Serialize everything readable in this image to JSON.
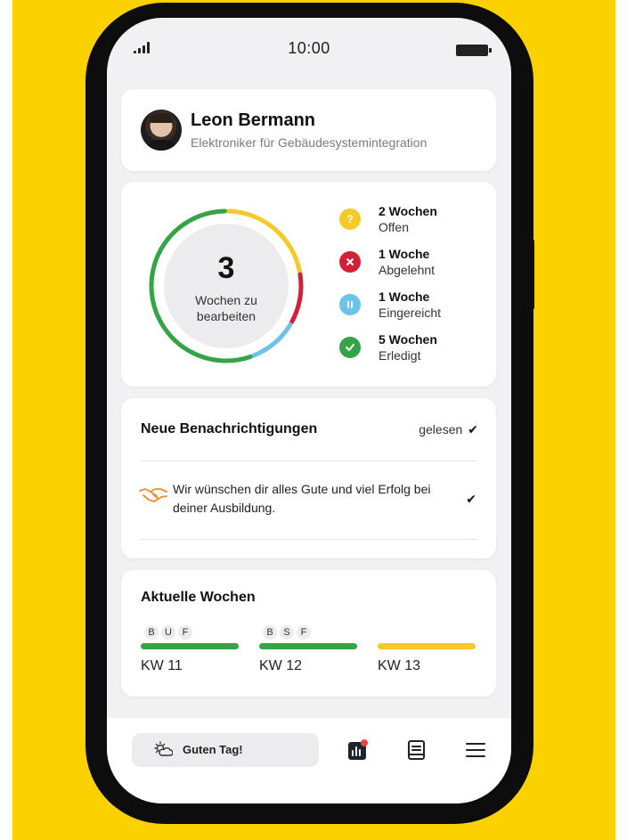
{
  "status_bar": {
    "time": "10:00"
  },
  "profile": {
    "name": "Leon Bermann",
    "role": "Elektroniker für Gebäudesystemintegration"
  },
  "summary": {
    "count": "3",
    "count_label_line1": "Wochen zu",
    "count_label_line2": "bearbeiten",
    "items": [
      {
        "title": "2 Wochen",
        "status": "Offen",
        "color": "#F5C927",
        "icon": "question-icon",
        "weeks": 2
      },
      {
        "title": "1 Woche",
        "status": "Abgelehnt",
        "color": "#D32036",
        "icon": "x-icon",
        "weeks": 1
      },
      {
        "title": "1 Woche",
        "status": "Eingereicht",
        "color": "#6CC3EA",
        "icon": "pause-icon",
        "weeks": 1
      },
      {
        "title": "5 Wochen",
        "status": "Erledigt",
        "color": "#35A447",
        "icon": "check-icon",
        "weeks": 5
      }
    ]
  },
  "notifications": {
    "title": "Neue Benachrichtigungen",
    "mark_read_label": "gelesen",
    "items": [
      {
        "text": "Wir wünschen dir alles Gute und viel Erfolg bei deiner Ausbildung.",
        "icon": "handshake-icon"
      }
    ]
  },
  "weeks": {
    "title": "Aktuelle Wochen",
    "items": [
      {
        "label": "KW 11",
        "chips": [
          "B",
          "U",
          "F"
        ],
        "color": "#35A447"
      },
      {
        "label": "KW 12",
        "chips": [
          "B",
          "S",
          "F"
        ],
        "color": "#35A447"
      },
      {
        "label": "KW 13",
        "chips": [],
        "color": "#F5C927"
      }
    ]
  },
  "bottom_nav": {
    "greeting": "Guten Tag!",
    "greeting_icon": "sun-cloud-icon",
    "icons": [
      "stats-icon",
      "book-icon",
      "menu-icon"
    ],
    "notification_dot_color": "#E8473C"
  },
  "brand": {
    "background": "#FBD200"
  }
}
